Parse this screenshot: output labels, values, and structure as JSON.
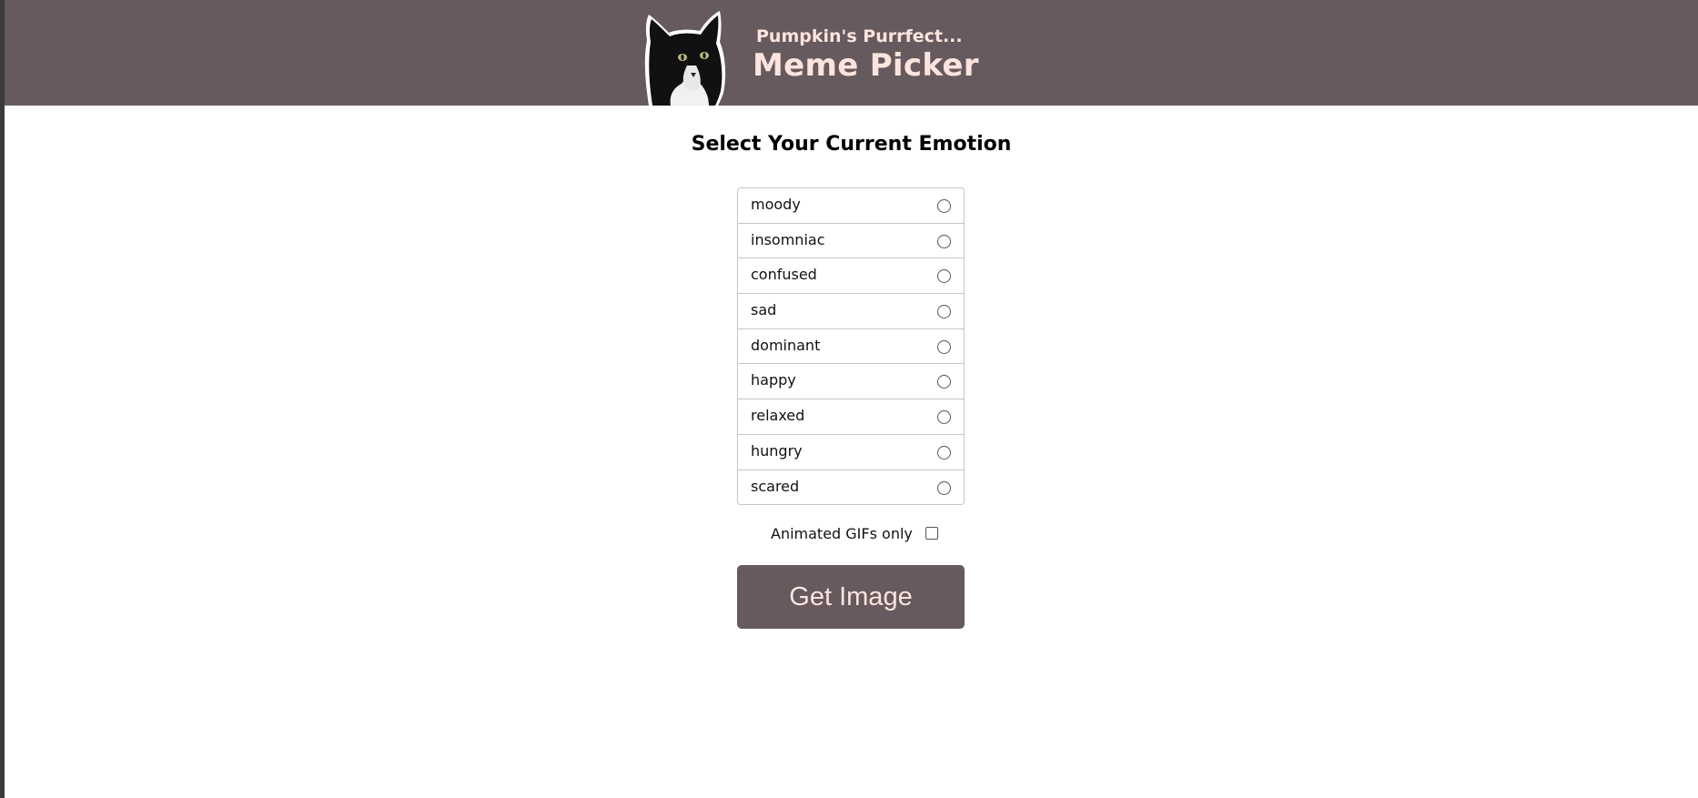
{
  "header": {
    "subtitle": "Pumpkin's Purrfect...",
    "title": "Meme Picker",
    "logo_icon": "cat-photo-icon"
  },
  "main": {
    "heading": "Select Your Current Emotion",
    "emotions": [
      {
        "label": "moody",
        "selected": false
      },
      {
        "label": "insomniac",
        "selected": false
      },
      {
        "label": "confused",
        "selected": false
      },
      {
        "label": "sad",
        "selected": false
      },
      {
        "label": "dominant",
        "selected": false
      },
      {
        "label": "happy",
        "selected": false
      },
      {
        "label": "relaxed",
        "selected": false
      },
      {
        "label": "hungry",
        "selected": false
      },
      {
        "label": "scared",
        "selected": false
      }
    ],
    "gif_label": "Animated GIFs only",
    "gif_checked": false,
    "button_label": "Get Image"
  },
  "colors": {
    "brand": "#675a5e",
    "accent_text": "#fce4de",
    "background": "#ffffff"
  }
}
